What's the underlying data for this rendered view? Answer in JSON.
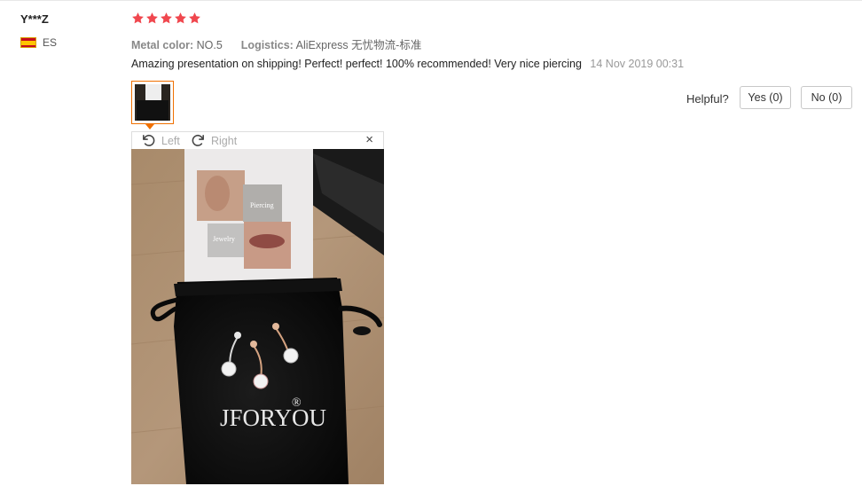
{
  "review": {
    "user": "Y***Z",
    "country_code": "ES",
    "rating": 5,
    "attributes": [
      {
        "key": "Metal color:",
        "value": "NO.5"
      },
      {
        "key": "Logistics:",
        "value": "AliExpress 无忧物流-标准"
      }
    ],
    "text": "Amazing presentation on shipping! Perfect! perfect! 100% recommended! Very nice piercing",
    "date": "14 Nov 2019 00:31"
  },
  "helpful": {
    "label": "Helpful?",
    "yes": "Yes (0)",
    "no": "No (0)"
  },
  "viewer": {
    "rotate_left": "Left",
    "rotate_right": "Right",
    "close": "×"
  },
  "photo": {
    "card_text_1": "Piercing",
    "card_text_2": "Jewelry",
    "bag_brand": "JFORYOU",
    "bag_mark": "®"
  },
  "colors": {
    "star": "#f0474e",
    "thumb_border": "#f07000",
    "date": "#999999"
  }
}
